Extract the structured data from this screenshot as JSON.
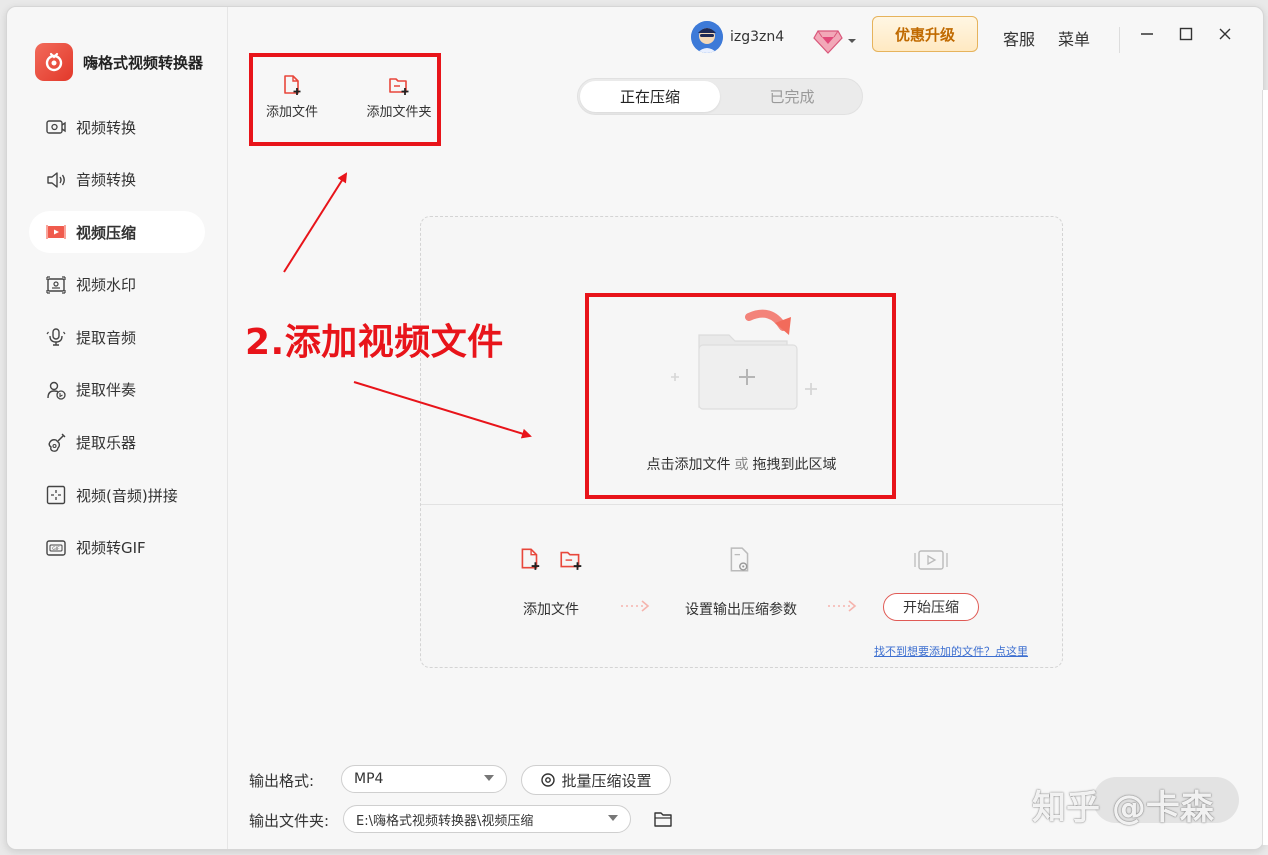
{
  "app": {
    "name": "嗨格式视频转换器"
  },
  "sidebar": {
    "items": [
      {
        "label": "视频转换",
        "icon": "video-convert-icon",
        "active": false
      },
      {
        "label": "音频转换",
        "icon": "audio-convert-icon",
        "active": false
      },
      {
        "label": "视频压缩",
        "icon": "video-compress-icon",
        "active": true
      },
      {
        "label": "视频水印",
        "icon": "video-watermark-icon",
        "active": false
      },
      {
        "label": "提取音频",
        "icon": "extract-audio-icon",
        "active": false
      },
      {
        "label": "提取伴奏",
        "icon": "extract-accompaniment-icon",
        "active": false
      },
      {
        "label": "提取乐器",
        "icon": "extract-instrument-icon",
        "active": false
      },
      {
        "label": "视频(音频)拼接",
        "icon": "merge-icon",
        "active": false
      },
      {
        "label": "视频转GIF",
        "icon": "gif-icon",
        "active": false
      }
    ]
  },
  "toolbar": {
    "add_file": "添加文件",
    "add_folder": "添加文件夹"
  },
  "header": {
    "username": "izg3zn4",
    "upgrade": "优惠升级",
    "service": "客服",
    "menu": "菜单"
  },
  "tabs": {
    "compressing": "正在压缩",
    "done": "已完成"
  },
  "dropzone": {
    "text_main": "点击添加文件",
    "text_or": "或",
    "text_drag": "拖拽到此区域",
    "step1": "添加文件",
    "step2": "设置输出压缩参数",
    "step3": "开始压缩",
    "help_link": "找不到想要添加的文件？点这里"
  },
  "annotation": {
    "text": "2.添加视频文件"
  },
  "bottom": {
    "format_label": "输出格式:",
    "format_value": "MP4",
    "batch_label": "批量压缩设置",
    "folder_label": "输出文件夹:",
    "folder_value": "E:\\嗨格式视频转换器\\视频压缩"
  },
  "watermark": {
    "text": "知乎 @卡森"
  },
  "colors": {
    "accent": "#e8473b",
    "annotation": "#e8141a",
    "link": "#3d6fd0"
  }
}
